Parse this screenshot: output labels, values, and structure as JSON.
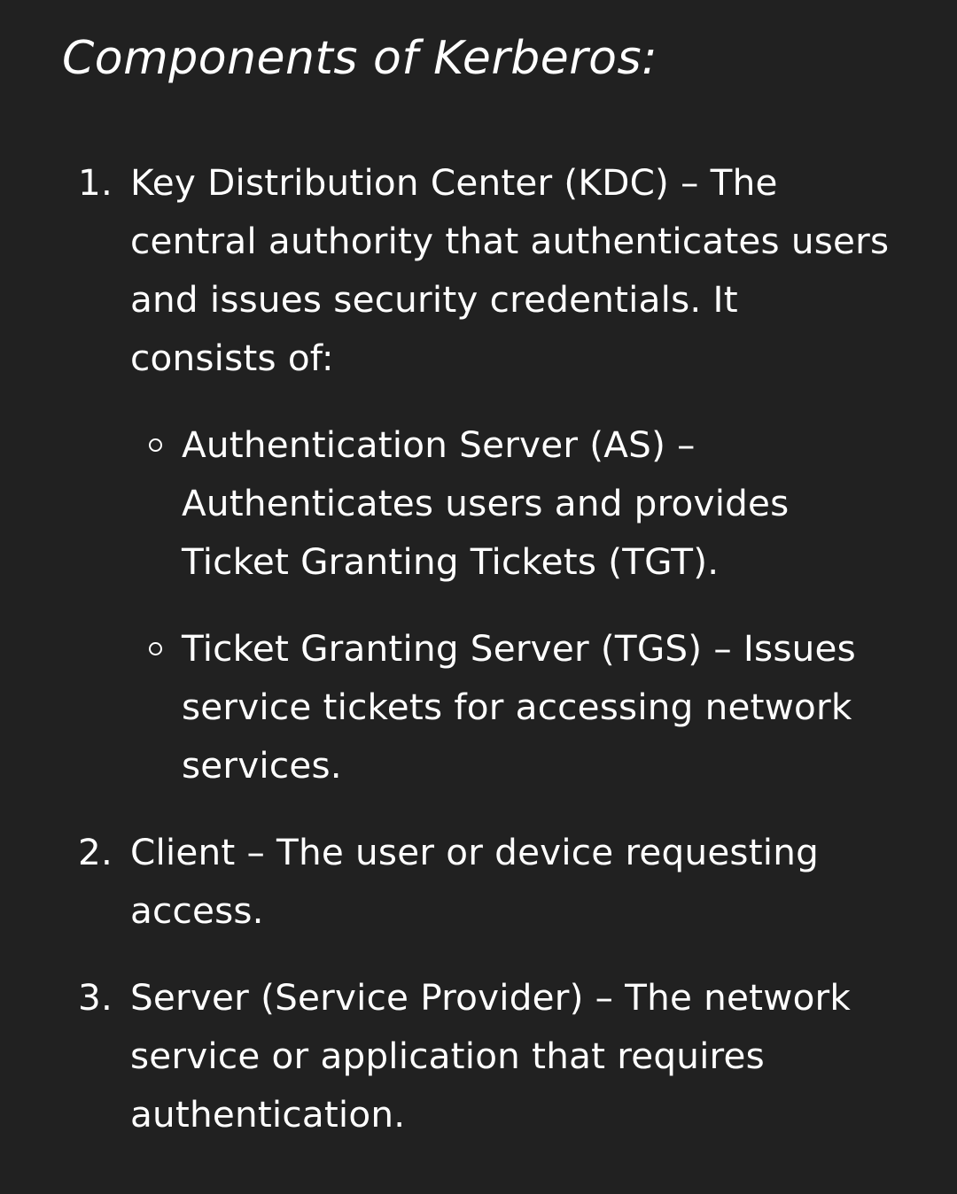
{
  "heading": "Components of Kerberos:",
  "items": [
    {
      "number": "1.",
      "text": "Key Distribution Center (KDC) – The central authority that authenticates users and issues security credentials. It consists of:",
      "subitems": [
        {
          "icon": "hollow-circle-bullet-icon",
          "text": "Authentication Server (AS) – Authenticates users and provides Ticket Granting Tickets (TGT)."
        },
        {
          "icon": "hollow-circle-bullet-icon",
          "text": "Ticket Granting Server (TGS) – Issues service tickets for accessing network services."
        }
      ]
    },
    {
      "number": "2.",
      "text": "Client – The user or device requesting access."
    },
    {
      "number": "3.",
      "text": "Server (Service Provider) – The network service or application that requires authentication."
    }
  ],
  "colors": {
    "background": "#212121",
    "text": "#ffffff"
  }
}
